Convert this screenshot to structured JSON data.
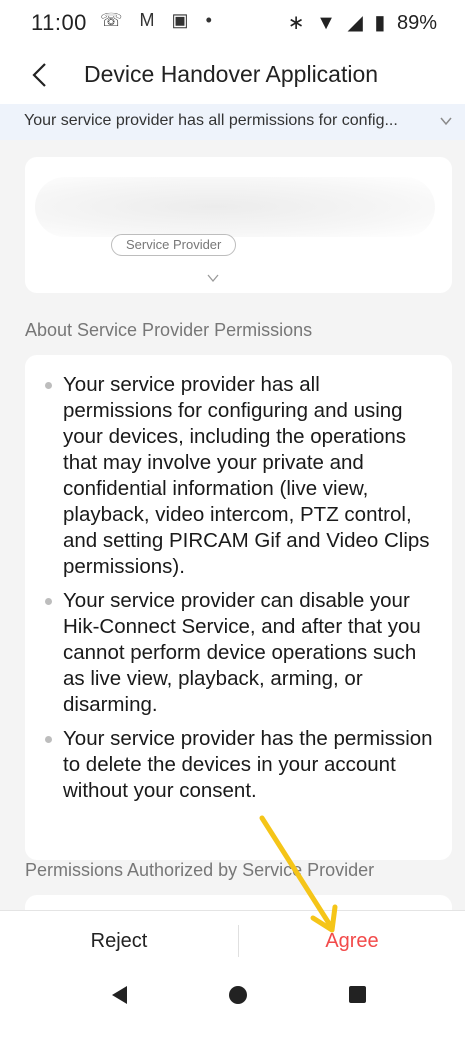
{
  "status_bar": {
    "time": "11:00",
    "battery": "89%",
    "left_icons": [
      "whatsapp-icon",
      "gmail-icon",
      "camera-icon",
      "dot-icon"
    ],
    "right_icons": [
      "bluetooth-icon",
      "wifi-icon",
      "signal-icon",
      "battery-icon"
    ]
  },
  "header": {
    "title": "Device Handover Application"
  },
  "banner": {
    "text": "Your service provider has all permissions for config..."
  },
  "provider_card": {
    "chip_label": "Service Provider"
  },
  "sections": {
    "about_title": "About Service Provider Permissions",
    "authorized_title": "Permissions Authorized by Service Provider"
  },
  "permissions": [
    "Your service provider has all permissions for configuring and using your devices, including the operations that may involve your private and confidential information (live view, playback, video intercom, PTZ control, and setting PIRCAM Gif and Video Clips permissions).",
    "Your service provider can disable your Hik-Connect Service, and after that you cannot perform device operations such as live view, playback, arming, or disarming.",
    "Your service provider has the permission to delete the devices in your account without your consent."
  ],
  "actions": {
    "reject_label": "Reject",
    "agree_label": "Agree"
  },
  "colors": {
    "accent_agree": "#f24a4a",
    "banner_bg": "#eef3fb",
    "page_bg": "#f4f4f4",
    "annotation_arrow": "#f5c518"
  }
}
